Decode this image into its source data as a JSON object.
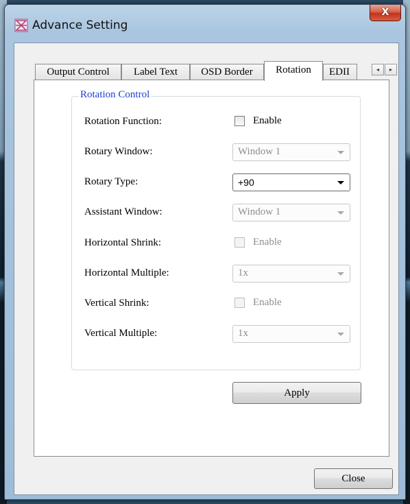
{
  "window": {
    "title": "Advance Setting",
    "close_glyph": "X",
    "icon": "app-icon"
  },
  "tabs": [
    {
      "label": "Output Control",
      "active": false
    },
    {
      "label": "Label Text",
      "active": false
    },
    {
      "label": "OSD Border",
      "active": false
    },
    {
      "label": "Rotation",
      "active": true
    },
    {
      "label": "EDII",
      "active": false
    }
  ],
  "tab_scroll": {
    "left_glyph": "◂",
    "right_glyph": "▸"
  },
  "group": {
    "title": "Rotation Control"
  },
  "rows": {
    "rotation_function": {
      "label": "Rotation Function:",
      "checkbox_label": "Enable",
      "checked": false
    },
    "rotary_window": {
      "label": "Rotary Window:",
      "value": "Window 1"
    },
    "rotary_type": {
      "label": "Rotary Type:",
      "value": "+90"
    },
    "assistant_window": {
      "label": "Assistant Window:",
      "value": "Window 1"
    },
    "horizontal_shrink": {
      "label": "Horizontal Shrink:",
      "checkbox_label": "Enable",
      "checked": false
    },
    "horizontal_multiple": {
      "label": "Horizontal Multiple:",
      "value": "1x"
    },
    "vertical_shrink": {
      "label": "Vertical Shrink:",
      "checkbox_label": "Enable",
      "checked": false
    },
    "vertical_multiple": {
      "label": "Vertical Multiple:",
      "value": "1x"
    }
  },
  "buttons": {
    "apply": "Apply",
    "close": "Close"
  },
  "colors": {
    "group_title": "#1a3fd6",
    "close_button": "#c2341c"
  }
}
